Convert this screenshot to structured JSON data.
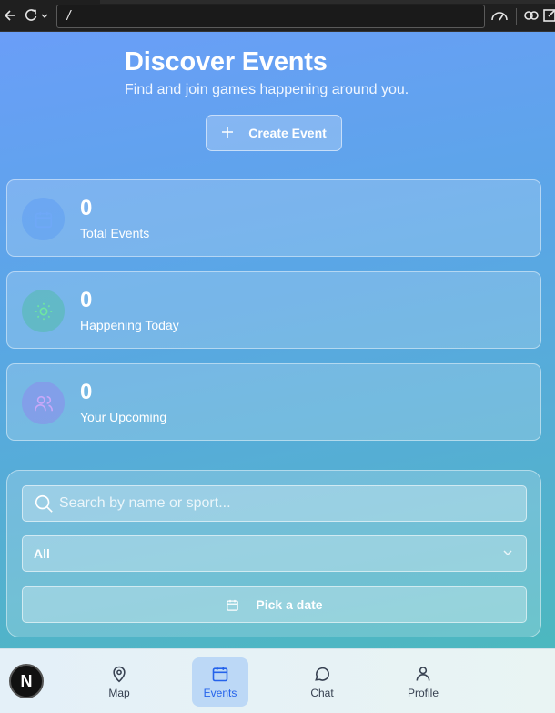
{
  "browser": {
    "address": "/"
  },
  "hero": {
    "title": "Discover Events",
    "subtitle": "Find and join games happening around you.",
    "create_button": "Create Event",
    "create_icon": "plus-icon"
  },
  "stats": [
    {
      "value": "0",
      "label": "Total Events",
      "icon": "calendar-icon",
      "color": "#3b82f6"
    },
    {
      "value": "0",
      "label": "Happening Today",
      "icon": "sun-icon",
      "color": "#22c55e"
    },
    {
      "value": "0",
      "label": "Your Upcoming",
      "icon": "users-icon",
      "color": "#a855f7"
    }
  ],
  "filters": {
    "search_placeholder": "Search by name or sport...",
    "select_value": "All",
    "date_button": "Pick a date"
  },
  "nav": {
    "avatar_letter": "N",
    "items": [
      {
        "label": "Map",
        "icon": "map-pin-icon",
        "active": false
      },
      {
        "label": "Events",
        "icon": "calendar-icon",
        "active": true
      },
      {
        "label": "Chat",
        "icon": "chat-bubble-icon",
        "active": false
      },
      {
        "label": "Profile",
        "icon": "user-icon",
        "active": false
      }
    ],
    "active_color": "#2563eb"
  }
}
